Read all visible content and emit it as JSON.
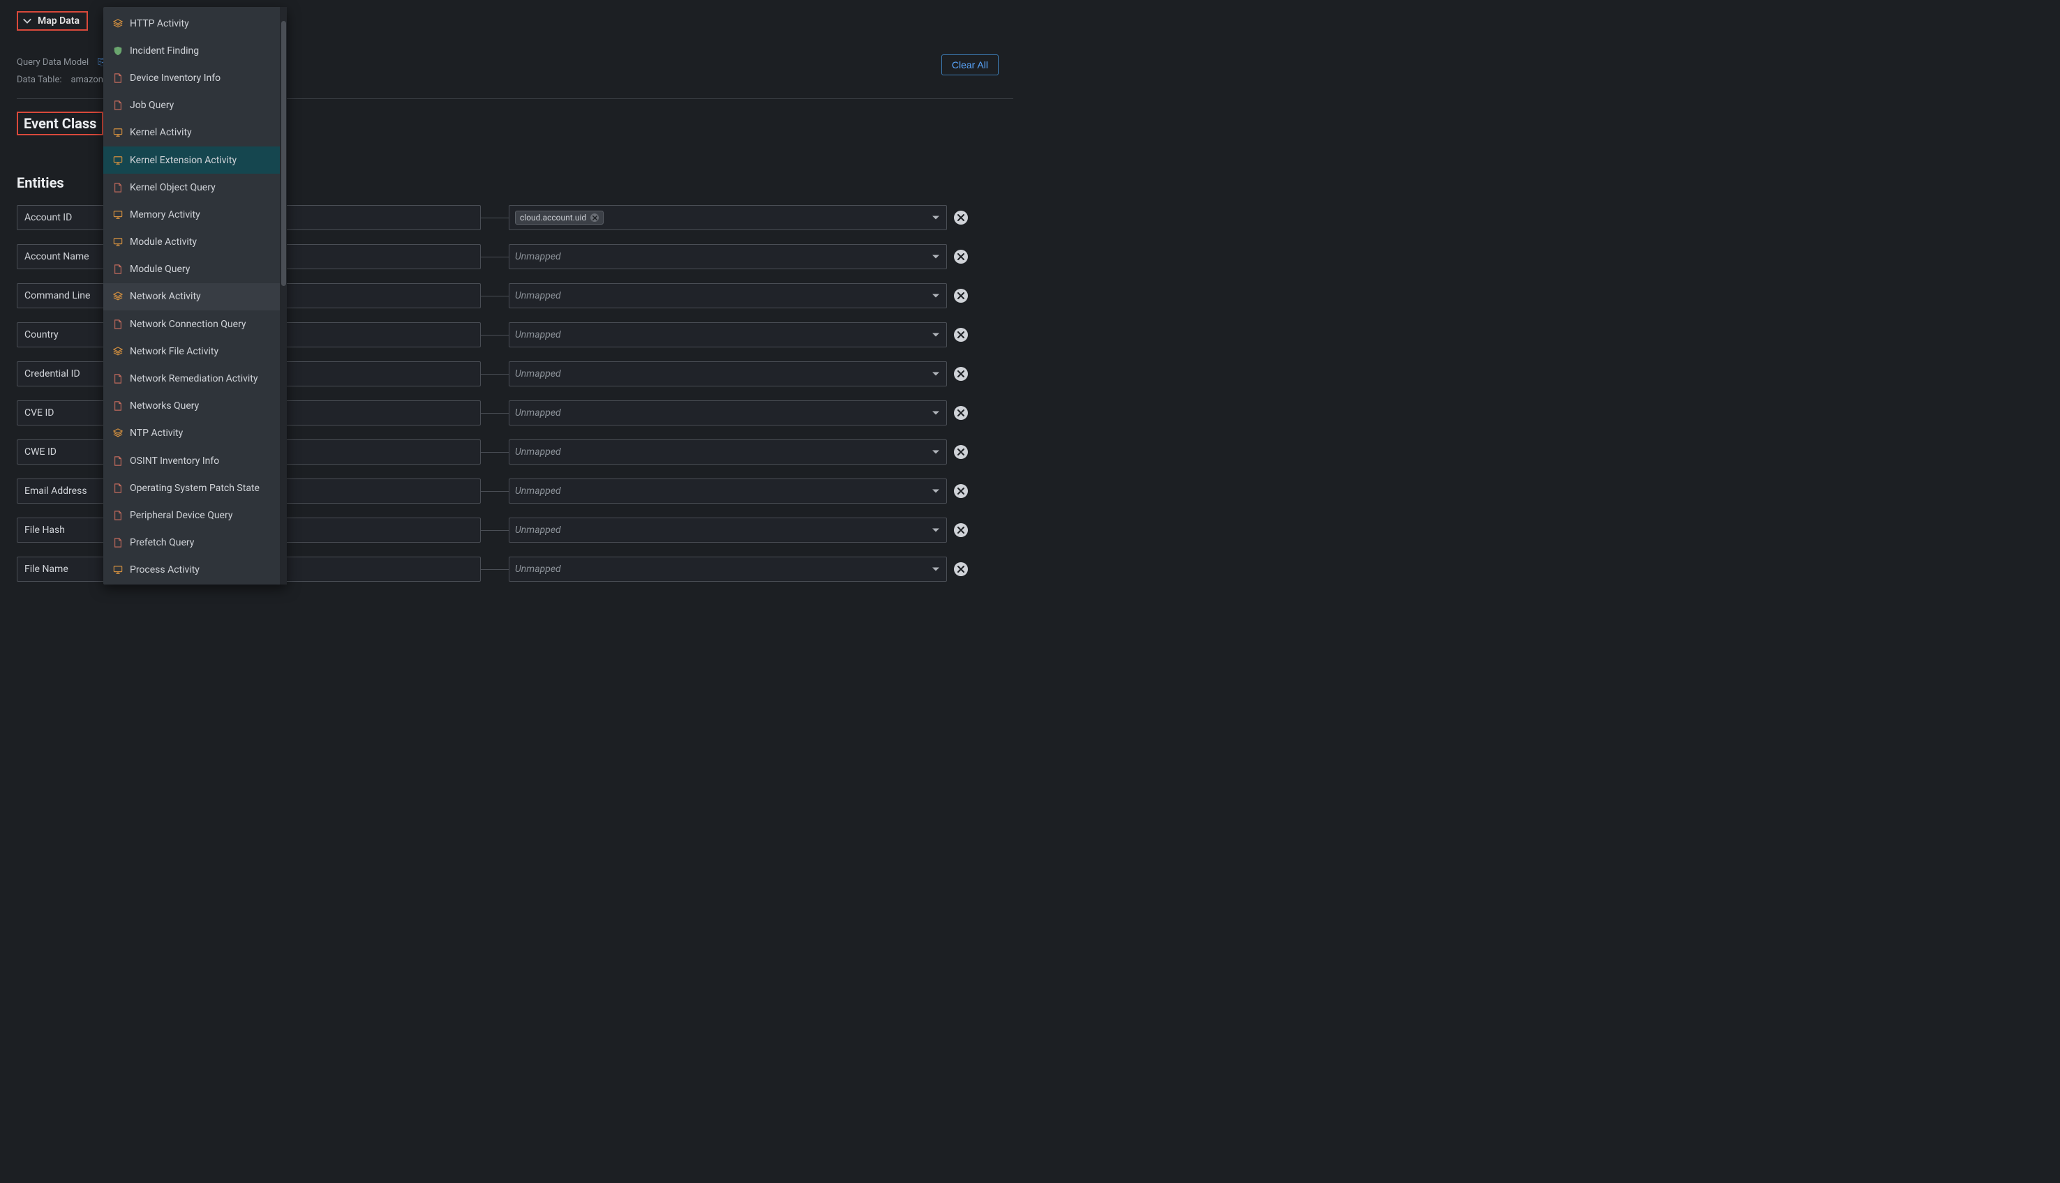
{
  "topbar": {
    "map_data_label": "Map Data"
  },
  "meta": {
    "query_label": "Query Data Model",
    "table_label": "Data Table:",
    "table_value": "amazon",
    "clear_all": "Clear All"
  },
  "headings": {
    "event_class": "Event Class",
    "entities": "Entities"
  },
  "unmapped_placeholder": "Unmapped",
  "chip": {
    "label": "cloud.account.uid"
  },
  "entities": [
    {
      "label": "Account ID",
      "mapped": true
    },
    {
      "label": "Account Name",
      "mapped": false
    },
    {
      "label": "Command Line",
      "mapped": false
    },
    {
      "label": "Country",
      "mapped": false
    },
    {
      "label": "Credential ID",
      "mapped": false
    },
    {
      "label": "CVE ID",
      "mapped": false
    },
    {
      "label": "CWE ID",
      "mapped": false
    },
    {
      "label": "Email Address",
      "mapped": false
    },
    {
      "label": "File Hash",
      "mapped": false
    },
    {
      "label": "File Name",
      "mapped": false
    }
  ],
  "menu": {
    "items": [
      {
        "label": "HTTP Activity",
        "icon": "layers",
        "color": "#d28f3f"
      },
      {
        "label": "Incident Finding",
        "icon": "shield",
        "color": "#6aa56e"
      },
      {
        "label": "Device Inventory Info",
        "icon": "doc",
        "color": "#c06a5c"
      },
      {
        "label": "Job Query",
        "icon": "doc",
        "color": "#c06a5c"
      },
      {
        "label": "Kernel Activity",
        "icon": "monitor",
        "color": "#d28f3f"
      },
      {
        "label": "Kernel Extension Activity",
        "icon": "monitor",
        "color": "#d28f3f",
        "selected": true
      },
      {
        "label": "Kernel Object Query",
        "icon": "doc",
        "color": "#c06a5c"
      },
      {
        "label": "Memory Activity",
        "icon": "monitor",
        "color": "#d28f3f"
      },
      {
        "label": "Module Activity",
        "icon": "monitor",
        "color": "#d28f3f"
      },
      {
        "label": "Module Query",
        "icon": "doc",
        "color": "#c06a5c"
      },
      {
        "label": "Network Activity",
        "icon": "layers",
        "color": "#d28f3f",
        "hover": true
      },
      {
        "label": "Network Connection Query",
        "icon": "doc",
        "color": "#c06a5c"
      },
      {
        "label": "Network File Activity",
        "icon": "layers",
        "color": "#d28f3f"
      },
      {
        "label": "Network Remediation Activity",
        "icon": "doc",
        "color": "#c06a5c"
      },
      {
        "label": "Networks Query",
        "icon": "doc",
        "color": "#c06a5c"
      },
      {
        "label": "NTP Activity",
        "icon": "layers",
        "color": "#d28f3f"
      },
      {
        "label": "OSINT Inventory Info",
        "icon": "doc",
        "color": "#c06a5c"
      },
      {
        "label": "Operating System Patch State",
        "icon": "doc",
        "color": "#c06a5c"
      },
      {
        "label": "Peripheral Device Query",
        "icon": "doc",
        "color": "#c06a5c"
      },
      {
        "label": "Prefetch Query",
        "icon": "doc",
        "color": "#c06a5c"
      },
      {
        "label": "Process Activity",
        "icon": "monitor",
        "color": "#d28f3f"
      }
    ]
  }
}
